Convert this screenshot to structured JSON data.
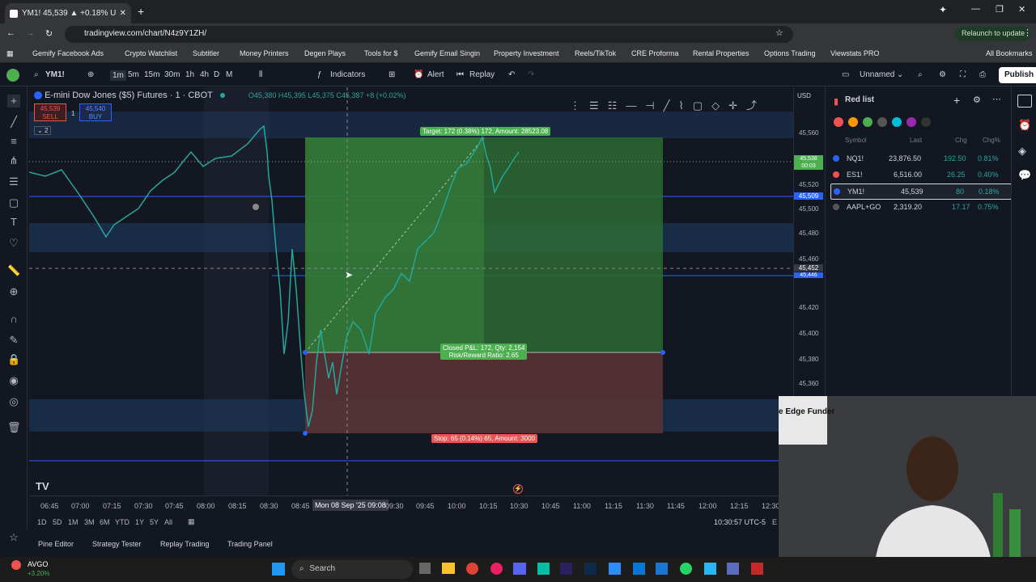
{
  "browser": {
    "tab_title": "YM1! 45,539 ▲ +0.18% Unnam",
    "url": "tradingview.com/chart/N4z9Y1ZH/",
    "relaunch": "Relaunch to update",
    "all_bookmarks": "All Bookmarks",
    "bookmarks": [
      "Gemify Facebook Ads",
      "Crypto Watchlist",
      "Subtitler",
      "Money Printers",
      "Degen Plays",
      "Tools for $",
      "Gemify Email Singin",
      "Property Investment",
      "Reels/TikTok",
      "CRE Proforma",
      "Rental Properties",
      "Options Trading",
      "Viewstats PRO"
    ]
  },
  "toolbar": {
    "symbol": "YM1!",
    "intervals": [
      "1m",
      "5m",
      "15m",
      "30m",
      "1h",
      "4h",
      "D",
      "M"
    ],
    "indicators": "Indicators",
    "alert": "Alert",
    "replay": "Replay",
    "layout_name": "Unnamed",
    "publish": "Publish"
  },
  "chart": {
    "title": "E-mini Dow Jones ($5) Futures · 1 · CBOT",
    "ohlc": "O45,380 H45,395 L45,375 C45,387 +8 (+0.02%)",
    "sell_price": "45,539",
    "sell_label": "SELL",
    "spread": "1",
    "buy_price": "45,540",
    "buy_label": "BUY",
    "indicator_count": "2",
    "currency": "USD",
    "target_label": "Target: 172 (0.38%) 172, Amount: 28523.08",
    "pnl_label_1": "Closed P&L: 172, Qty: 2,154",
    "pnl_label_2": "Risk/Reward Ratio: 2.65",
    "stop_label": "Stop: 65 (0.14%) 65, Amount: 3000",
    "price_ticks": [
      "45,560",
      "45,540",
      "45,520",
      "45,500",
      "45,480",
      "45,460",
      "45,440",
      "45,420",
      "45,400",
      "45,380",
      "45,360"
    ],
    "price_tag_current": "45,538",
    "price_tag_countdown": "00:03",
    "price_tag_blue": "45,509",
    "price_tag_cross": "45,452",
    "price_tag_cross2": "45,446",
    "time_ticks": [
      "06:45",
      "07:00",
      "07:15",
      "07:30",
      "07:45",
      "08:00",
      "08:15",
      "08:30",
      "08:45",
      "09:08",
      "09:30",
      "09:45",
      "10:00",
      "10:15",
      "10:30",
      "10:45",
      "11:00",
      "11:15",
      "11:30",
      "11:45",
      "12:00",
      "12:15",
      "12:30"
    ],
    "time_cursor": "Mon 08 Sep '25",
    "ranges": [
      "1D",
      "5D",
      "1M",
      "3M",
      "6M",
      "YTD",
      "1Y",
      "5Y",
      "All"
    ],
    "clock": "10:30:57 UTC-5",
    "tz_suffix": "E"
  },
  "bottom_tabs": [
    "Pine Editor",
    "Strategy Tester",
    "Replay Trading",
    "Trading Panel"
  ],
  "watchlist": {
    "name": "Red list",
    "headers": [
      "Symbol",
      "Last",
      "Chg",
      "Chg%"
    ],
    "rows": [
      {
        "symbol": "NQ1!",
        "last": "23,876.50",
        "chg": "192.50",
        "chgp": "0.81%"
      },
      {
        "symbol": "ES1!",
        "last": "6,516.00",
        "chg": "26.25",
        "chgp": "0.40%"
      },
      {
        "symbol": "YM1!",
        "last": "45,539",
        "chg": "80",
        "chgp": "0.18%"
      },
      {
        "symbol": "AAPL+GO",
        "last": "2,319.20",
        "chg": "17.17",
        "chgp": "0.75%"
      }
    ]
  },
  "taskbar": {
    "ticker": "AVGO",
    "ticker_change": "+3.20%",
    "search": "Search"
  },
  "webcam": {
    "sign_text": "e Edge Funder"
  },
  "colors": {
    "green": "#26a69a",
    "red": "#ef5350",
    "blue": "#2962ff",
    "target_zone": "#2d6a32",
    "stop_zone": "#5c3535"
  }
}
